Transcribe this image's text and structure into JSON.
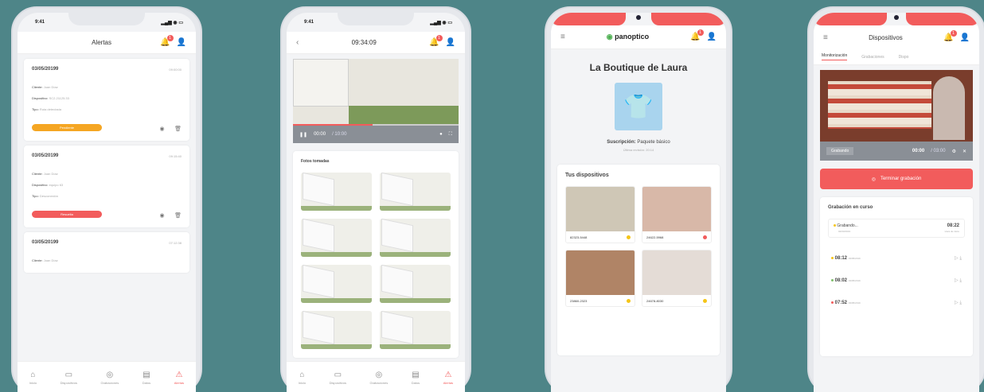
{
  "colors": {
    "accent": "#f25c5c",
    "warning": "#f5a623",
    "background": "#4e8588"
  },
  "phone1": {
    "time": "9:41",
    "title": "Alertas",
    "badge": "1",
    "alerts": [
      {
        "date": "03/05/20199",
        "time": "09:00:00",
        "lines": [
          [
            "Cliente:",
            "Juan Díaz"
          ],
          [
            "Dispositivo:",
            "SC2.21125.33"
          ],
          [
            "Tipo:",
            "Ruta detectada"
          ]
        ],
        "status": "Pendiente",
        "color": "#f5a623"
      },
      {
        "date": "03/05/20199",
        "time": "09:15:40",
        "lines": [
          [
            "Cliente:",
            "Juan Díaz"
          ],
          [
            "Dispositivo:",
            "equipo 63"
          ],
          [
            "Tipo:",
            "Desconexión"
          ]
        ],
        "status": "Resuelta",
        "color": "#f25c5c"
      },
      {
        "date": "03/05/20199",
        "time": "07:12:38",
        "lines": [
          [
            "Cliente:",
            "Juan Díaz"
          ]
        ]
      }
    ],
    "tabs": [
      "Inicio",
      "Dispositivos",
      "Grabaciones",
      "Datos",
      "Alertas"
    ]
  },
  "phone2": {
    "time": "9:41",
    "title": "09:34:09",
    "badge": "1",
    "player_time": "00:00",
    "player_total": "/ 10:00",
    "section_title": "Fotos tomadas",
    "tabs": [
      "Inicio",
      "Dispositivos",
      "Grabaciones",
      "Datos",
      "Alertas"
    ]
  },
  "phone3": {
    "brand": "panoptico",
    "badge": "1",
    "store_name": "La Boutique de Laura",
    "subscription_label": "Suscripción:",
    "subscription_value": "Paquete básico",
    "subscription_note": "Última revisión: 20:14",
    "devices_title": "Tus dispositivos",
    "devices": [
      {
        "id": "82323-5448",
        "status": "#f5c518"
      },
      {
        "id": "24622-5968",
        "status": "#f25c5c"
      },
      {
        "id": "23860-2323",
        "status": "#f5c518"
      },
      {
        "id": "24678-8030",
        "status": "#f5c518"
      }
    ]
  },
  "phone4": {
    "title": "Dispositivos",
    "badge": "1",
    "tabs": [
      "Monitorización",
      "Grabaciones",
      "Dispo"
    ],
    "player_label": "Grabando",
    "player_time": "00:00",
    "player_total": "/ 03:00",
    "finish_button": "Terminar grabación",
    "recording_title": "Grabación en curso",
    "current": {
      "label": "Grabando...",
      "sub": "02/03/2019",
      "time": "08:22",
      "time_sub": "Hora de inicio"
    },
    "history": [
      {
        "time": "08:12",
        "date": "03/05/2019",
        "color": "#f5c518"
      },
      {
        "time": "08:02",
        "date": "03/05/2019",
        "color": "#7fbf6a"
      },
      {
        "time": "07:52",
        "date": "03/05/2019",
        "color": "#f25c5c"
      }
    ]
  }
}
